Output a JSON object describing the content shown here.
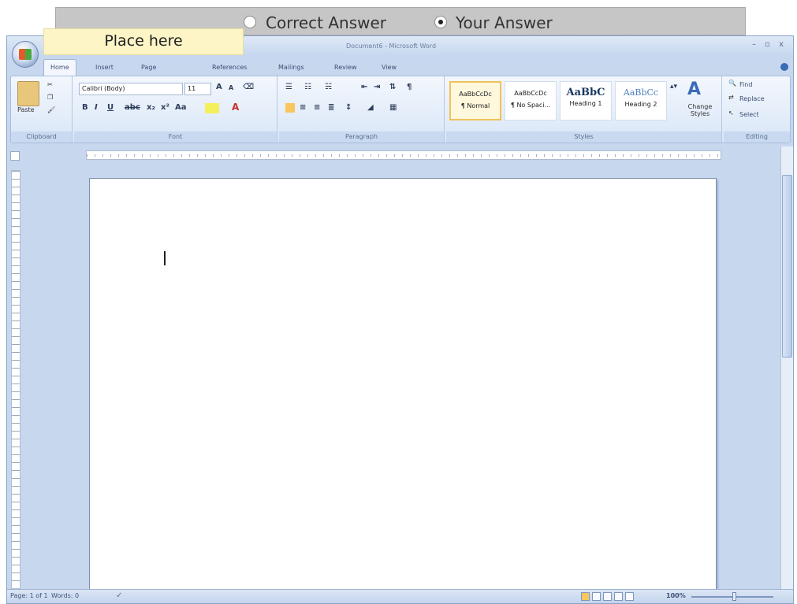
{
  "quiz": {
    "correct_label": "Correct Answer",
    "your_label": "Your Answer",
    "selected": "your"
  },
  "overlay": {
    "place_here": "Place here"
  },
  "window": {
    "title": "Document6 - Microsoft Word",
    "controls": "– ▫ x"
  },
  "tabs": [
    "Home",
    "Insert",
    "Page Layout",
    "References",
    "Mailings",
    "Review",
    "View"
  ],
  "ribbon": {
    "clipboard": {
      "label": "Clipboard",
      "paste": "Paste"
    },
    "font": {
      "label": "Font",
      "name": "Calibri (Body)",
      "size": "11",
      "bold": "B",
      "italic": "I",
      "underline": "U"
    },
    "paragraph": {
      "label": "Paragraph"
    },
    "styles": {
      "label": "Styles",
      "items": [
        {
          "preview": "AaBbCcDc",
          "name": "¶ Normal"
        },
        {
          "preview": "AaBbCcDc",
          "name": "¶ No Spaci..."
        },
        {
          "preview": "AaBbC",
          "name": "Heading 1"
        },
        {
          "preview": "AaBbCc",
          "name": "Heading 2"
        }
      ],
      "change_styles": "Change Styles"
    },
    "editing": {
      "label": "Editing",
      "find": "Find",
      "replace": "Replace",
      "select": "Select"
    }
  },
  "status": {
    "page": "Page: 1 of 1",
    "words": "Words: 0",
    "zoom": "100%"
  },
  "colors": {
    "quiz_bar": "#c6c6c6",
    "place_here_bg": "#fdf5c6",
    "window_bg": "#c7d7ee"
  }
}
